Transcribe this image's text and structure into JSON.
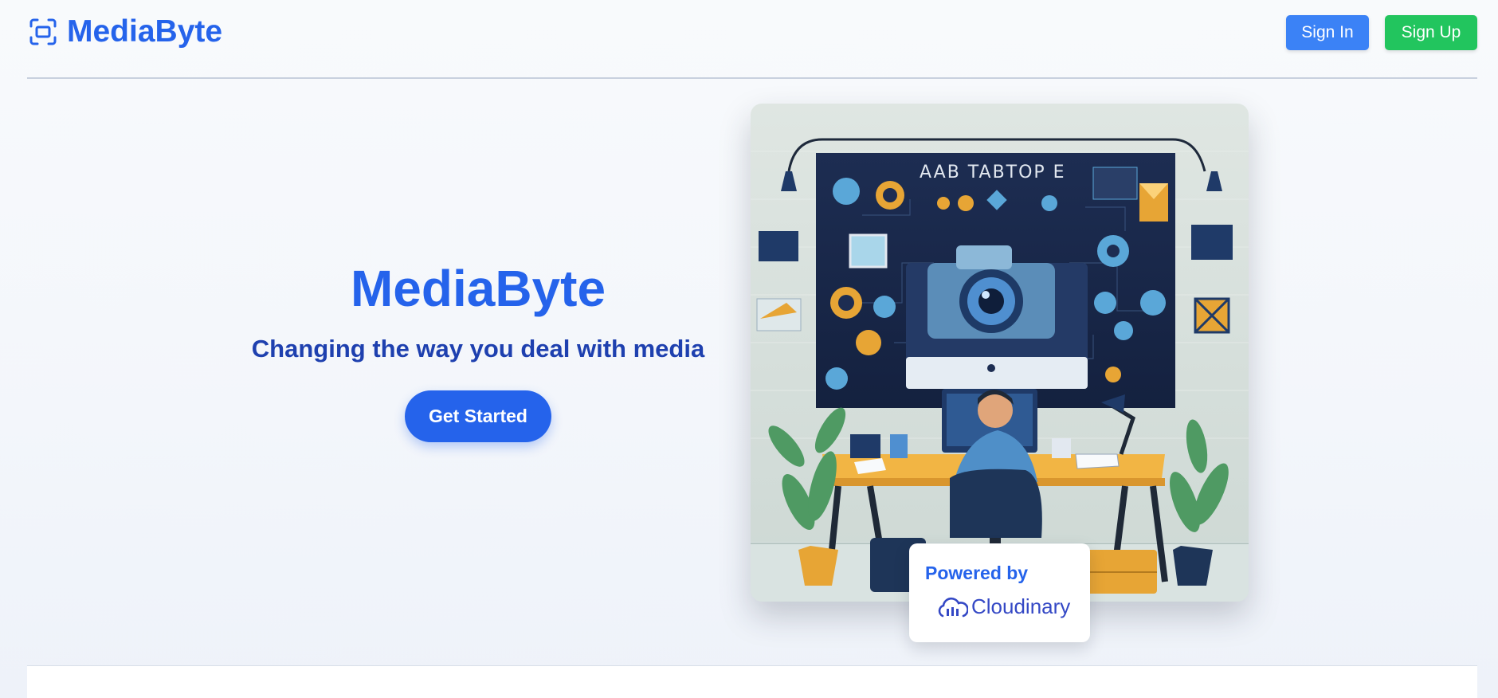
{
  "header": {
    "brand_name": "MediaByte",
    "brand_icon": "scan-frame-icon",
    "sign_in_label": "Sign In",
    "sign_up_label": "Sign Up"
  },
  "hero": {
    "title": "MediaByte",
    "tagline": "Changing the way you deal with media",
    "cta_label": "Get Started"
  },
  "illustration": {
    "screen_text": "AAB TABTOP E"
  },
  "powered_badge": {
    "label": "Powered by",
    "logo_text": "Cloudinary"
  },
  "colors": {
    "brand_blue": "#2563eb",
    "tagline_blue": "#1e40af",
    "sign_in_blue": "#3b82f6",
    "sign_up_green": "#22c55e",
    "cloudinary_blue": "#3448c5"
  }
}
